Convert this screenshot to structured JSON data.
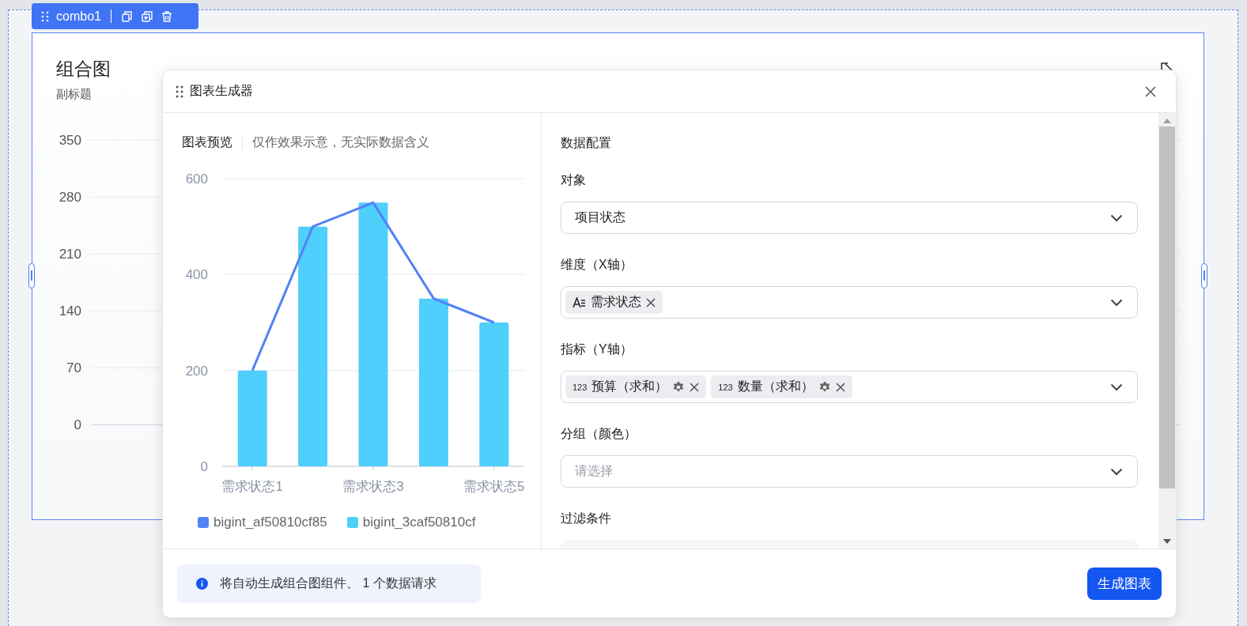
{
  "toolbar": {
    "label": "combo1"
  },
  "component": {
    "title": "组合图",
    "subtitle": "副标题",
    "yticks": [
      "350",
      "280",
      "210",
      "140",
      "70",
      "0"
    ]
  },
  "dialog": {
    "title": "图表生成器",
    "preview": {
      "title": "图表预览",
      "note": "仅作效果示意，无实际数据含义",
      "chart_data": {
        "type": "bar",
        "categories": [
          "需求状态1",
          null,
          "需求状态3",
          null,
          "需求状态5"
        ],
        "ylim": [
          0,
          600
        ],
        "yticks": [
          0,
          200,
          400,
          600
        ],
        "legend": "bottom",
        "series": [
          {
            "name": "bigint_af50810cf85",
            "type": "line",
            "color": "#5282f7",
            "values": [
              200,
              500,
              550,
              350,
              300
            ]
          },
          {
            "name": "bigint_3caf50810cf",
            "type": "bar",
            "color": "#4fcffb",
            "values": [
              200,
              500,
              550,
              350,
              300
            ]
          }
        ]
      }
    },
    "config": {
      "title": "数据配置",
      "fields": [
        {
          "label": "对象",
          "kind": "select",
          "value": "项目状态"
        },
        {
          "label": "维度（X轴）",
          "kind": "tags",
          "tags": [
            {
              "kind": "text",
              "label": "需求状态",
              "settings": false
            }
          ]
        },
        {
          "label": "指标（Y轴）",
          "kind": "tags",
          "tags": [
            {
              "kind": "number",
              "type_text": "123",
              "label": "预算（求和）",
              "settings": true
            },
            {
              "kind": "number",
              "type_text": "123",
              "label": "数量（求和）",
              "settings": true
            }
          ]
        },
        {
          "label": "分组（颜色）",
          "kind": "select",
          "placeholder": "请选择"
        },
        {
          "label": "过滤条件",
          "kind": "filter"
        }
      ]
    },
    "footer": {
      "info": "将自动生成组合图组件、 1 个数据请求",
      "button": "生成图表"
    }
  }
}
